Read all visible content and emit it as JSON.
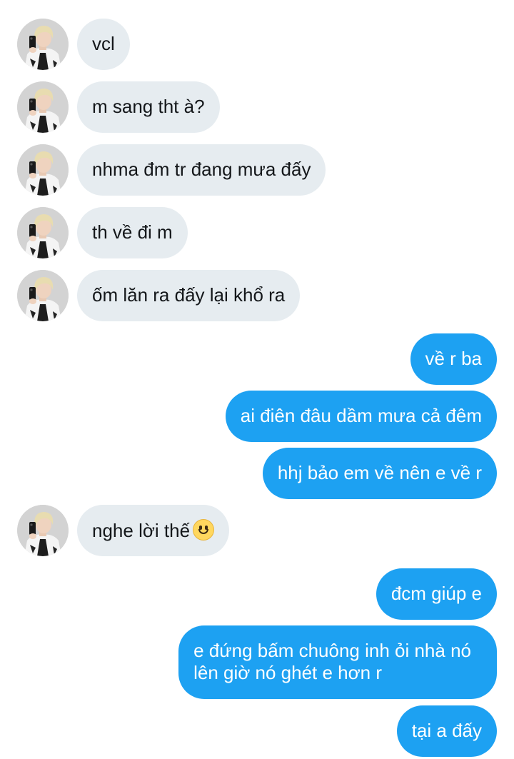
{
  "colors": {
    "incoming_bubble": "#e6ecf0",
    "outgoing_bubble": "#1da1f2",
    "background": "#ffffff"
  },
  "contact": {
    "avatar_icon": "profile-photo-avatar"
  },
  "messages": [
    {
      "side": "in",
      "text": "vcl"
    },
    {
      "side": "in",
      "text": "m sang tht à?"
    },
    {
      "side": "in",
      "text": "nhma đm tr đang mưa đấy"
    },
    {
      "side": "in",
      "text": "th về đi m"
    },
    {
      "side": "in",
      "text": "ốm lăn ra đấy lại khổ ra"
    },
    {
      "side": "out",
      "text": "về r ba"
    },
    {
      "side": "out",
      "text": "ai điên đâu dầm mưa cả đêm"
    },
    {
      "side": "out",
      "text": "hhj bảo em về nên e về r"
    },
    {
      "side": "in",
      "text": "nghe lời thế",
      "emoji": "slightly-smiling-face-icon"
    },
    {
      "side": "out",
      "text": "đcm giúp e"
    },
    {
      "side": "out",
      "lines": [
        "e đứng bấm chuông inh ỏi nhà nó",
        "lên giờ nó ghét e hơn r"
      ]
    },
    {
      "side": "out",
      "text": "tại a đấy"
    }
  ]
}
